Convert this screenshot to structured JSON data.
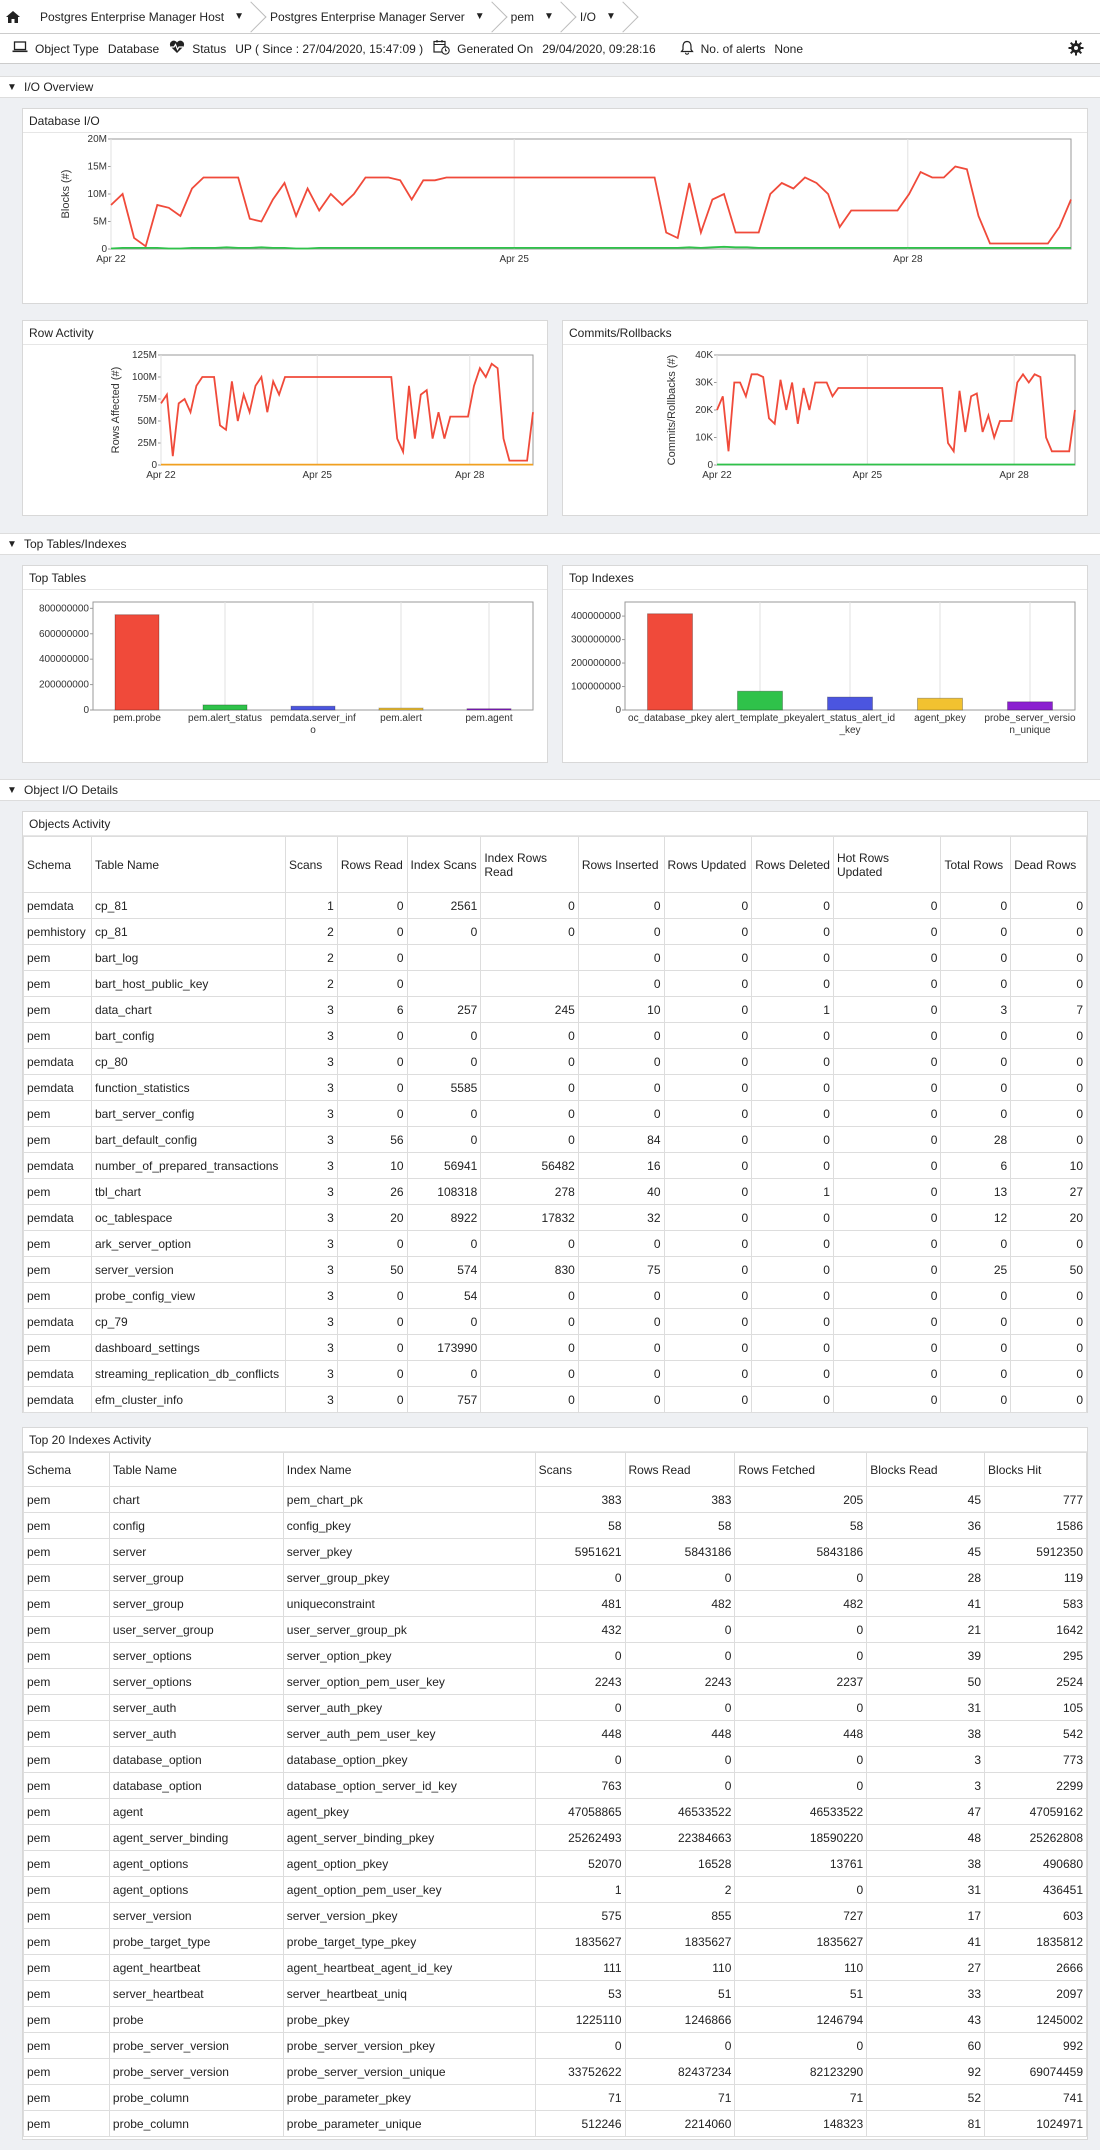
{
  "breadcrumb": [
    {
      "label": "Postgres Enterprise Manager Host"
    },
    {
      "label": "Postgres Enterprise Manager Server"
    },
    {
      "label": "pem"
    },
    {
      "label": "I/O"
    }
  ],
  "info": {
    "object_type_label": "Object Type",
    "object_type_value": "Database",
    "status_label": "Status",
    "status_value": "UP ( Since : 27/04/2020, 15:47:09 )",
    "generated_label": "Generated On",
    "generated_value": "29/04/2020, 09:28:16",
    "alerts_label": "No. of alerts",
    "alerts_value": "None"
  },
  "sections": {
    "io_overview": "I/O Overview",
    "top_tables_indexes": "Top Tables/Indexes",
    "object_io_details": "Object I/O Details"
  },
  "colors": {
    "red": "#f04a3a",
    "green": "#2fc24a",
    "blue": "#4b55e0",
    "yellow": "#f2c230",
    "purple": "#8b1fd0",
    "orange": "#f0a020"
  },
  "chart_data": [
    {
      "id": "database_io",
      "type": "line",
      "title": "Database I/O",
      "ylabel": "Blocks (#)",
      "ylim": [
        0,
        20000000
      ],
      "yticks": [
        "0",
        "5M",
        "10M",
        "15M",
        "20M"
      ],
      "xticks": [
        "Apr 22",
        "Apr 25",
        "Apr 28"
      ],
      "series": [
        {
          "color": "#f04a3a",
          "values": [
            8,
            10,
            2,
            0.5,
            8,
            7.5,
            6,
            11,
            13,
            13,
            13,
            13,
            5.5,
            5,
            9,
            12,
            6,
            11,
            7,
            10,
            8,
            10,
            13,
            13,
            13,
            12.5,
            9,
            12.5,
            12.5,
            13,
            13,
            13,
            13,
            13,
            13,
            13,
            13,
            13,
            13,
            13,
            13,
            13,
            13,
            13,
            13,
            13,
            13,
            13,
            3,
            2,
            12,
            3,
            9,
            10,
            3,
            3,
            3,
            10,
            12,
            11,
            13,
            12,
            10,
            4,
            7,
            7,
            7,
            7,
            7,
            10,
            14,
            13,
            13,
            15,
            14.5,
            6,
            1,
            1,
            1,
            1,
            1,
            1,
            4,
            9
          ]
        },
        {
          "color": "#2fc24a",
          "values": [
            0.1,
            0.2,
            0.2,
            0.2,
            0.2,
            0.1,
            0.1,
            0.2,
            0.2,
            0.2,
            0.3,
            0.2,
            0.2,
            0.3,
            0.2,
            0.2,
            0.1,
            0.1,
            0.2,
            0.2,
            0.2,
            0.2,
            0.2,
            0.2,
            0.2,
            0.2,
            0.2,
            0.2,
            0.2,
            0.2,
            0.2,
            0.2,
            0.2,
            0.2,
            0.2,
            0.2,
            0.2,
            0.2,
            0.2,
            0.2,
            0.2,
            0.2,
            0.2,
            0.2,
            0.2,
            0.2,
            0.2,
            0.2,
            0.2,
            0.2,
            0.3,
            0.2,
            0.3,
            0.4,
            0.3,
            0.3,
            0.2,
            0.2,
            0.2,
            0.2,
            0.2,
            0.2,
            0.2,
            0.2,
            0.2,
            0.2,
            0.2,
            0.2,
            0.2,
            0.2,
            0.2,
            0.2,
            0.2,
            0.2,
            0.2,
            0.2,
            0.2,
            0.2,
            0.2,
            0.2,
            0.2,
            0.2,
            0.2,
            0.2
          ]
        }
      ]
    },
    {
      "id": "row_activity",
      "type": "line",
      "title": "Row Activity",
      "ylabel": "Rows Affected (#)",
      "ylim": [
        0,
        125000000
      ],
      "yticks": [
        "0",
        "25M",
        "50M",
        "75M",
        "100M",
        "125M"
      ],
      "xticks": [
        "Apr 22",
        "Apr 25",
        "Apr 28"
      ],
      "series": [
        {
          "color": "#f04a3a",
          "values": [
            70,
            80,
            10,
            70,
            75,
            60,
            90,
            100,
            100,
            100,
            45,
            40,
            95,
            50,
            80,
            60,
            90,
            100,
            60,
            95,
            80,
            100,
            100,
            100,
            100,
            100,
            100,
            100,
            100,
            100,
            100,
            100,
            100,
            100,
            100,
            100,
            100,
            100,
            100,
            100,
            30,
            15,
            90,
            30,
            80,
            85,
            30,
            60,
            30,
            55,
            55,
            55,
            55,
            90,
            110,
            100,
            115,
            110,
            30,
            5,
            5,
            5,
            5,
            60
          ]
        },
        {
          "color": "#f0a020",
          "values": [
            0.5,
            0.5,
            0.5,
            0.5,
            0.5,
            0.5,
            0.5,
            0.5,
            0.5,
            0.5,
            0.5,
            0.5,
            0.5,
            0.5,
            0.5,
            0.5,
            0.5,
            0.5,
            0.5,
            0.5,
            0.5,
            0.5,
            0.5,
            0.5,
            0.5,
            0.5,
            0.5,
            0.5,
            0.5,
            0.5,
            0.5,
            0.5,
            0.5,
            0.5,
            0.5,
            0.5,
            0.5,
            0.5,
            0.5,
            0.5,
            0.5,
            0.5,
            0.5,
            0.5,
            0.5,
            0.5,
            0.5,
            0.5,
            0.5,
            0.5,
            0.5,
            0.5,
            0.5,
            0.5,
            0.5,
            0.5,
            0.5,
            0.5,
            0.5,
            0.5,
            0.5,
            0.5,
            0.5,
            0.5
          ]
        }
      ]
    },
    {
      "id": "commits_rollbacks",
      "type": "line",
      "title": "Commits/Rollbacks",
      "ylabel": "Commits/Rollbacks (#)",
      "ylim": [
        0,
        40000
      ],
      "yticks": [
        "0",
        "10K",
        "20K",
        "30K",
        "40K"
      ],
      "xticks": [
        "Apr 22",
        "Apr 25",
        "Apr 28"
      ],
      "series": [
        {
          "color": "#f04a3a",
          "values": [
            20,
            25,
            5,
            30,
            30,
            25,
            33,
            33,
            32,
            17,
            15,
            31,
            20,
            30,
            15,
            28,
            20,
            30,
            30,
            30,
            25,
            28,
            28,
            28,
            28,
            28,
            28,
            28,
            28,
            28,
            28,
            28,
            28,
            28,
            28,
            28,
            28,
            28,
            28,
            28,
            8,
            5,
            27,
            12,
            25,
            26,
            12,
            18,
            10,
            16,
            16,
            16,
            30,
            33,
            30,
            33,
            32,
            10,
            5,
            5,
            5,
            5,
            20
          ]
        },
        {
          "color": "#2fc24a",
          "values": [
            0.2,
            0.2,
            0.2,
            0.2,
            0.2,
            0.2,
            0.2,
            0.2,
            0.2,
            0.2,
            0.2,
            0.2,
            0.2,
            0.2,
            0.2,
            0.2,
            0.2,
            0.2,
            0.2,
            0.2,
            0.2,
            0.2,
            0.2,
            0.2,
            0.2,
            0.2,
            0.2,
            0.2,
            0.2,
            0.2,
            0.2,
            0.2,
            0.2,
            0.2,
            0.2,
            0.2,
            0.2,
            0.2,
            0.2,
            0.2,
            0.2,
            0.2,
            0.2,
            0.2,
            0.2,
            0.2,
            0.2,
            0.2,
            0.2,
            0.2,
            0.2,
            0.2,
            0.2,
            0.2,
            0.2,
            0.2,
            0.2,
            0.2,
            0.2,
            0.2,
            0.2,
            0.2,
            0.2
          ]
        }
      ]
    },
    {
      "id": "top_tables",
      "type": "bar",
      "title": "Top Tables",
      "ylim": [
        0,
        850000000
      ],
      "yticks": [
        "0",
        "200000000",
        "400000000",
        "600000000",
        "800000000"
      ],
      "categories": [
        [
          "pem.probe"
        ],
        [
          "pem.alert_status"
        ],
        [
          "pemdata.server_inf",
          "o"
        ],
        [
          "pem.alert"
        ],
        [
          "pem.agent"
        ]
      ],
      "values": [
        750000000,
        40000000,
        30000000,
        15000000,
        10000000
      ],
      "colors": [
        "#f04a3a",
        "#2fc24a",
        "#4b55e0",
        "#f2c230",
        "#8b1fd0"
      ]
    },
    {
      "id": "top_indexes",
      "type": "bar",
      "title": "Top Indexes",
      "ylim": [
        0,
        460000000
      ],
      "yticks": [
        "0",
        "100000000",
        "200000000",
        "300000000",
        "400000000"
      ],
      "categories": [
        [
          "oc_database_pkey"
        ],
        [
          "alert_template_pkey"
        ],
        [
          "alert_status_alert_id",
          "_key"
        ],
        [
          "agent_pkey"
        ],
        [
          "probe_server_versio",
          "n_unique"
        ]
      ],
      "values": [
        410000000,
        80000000,
        55000000,
        50000000,
        35000000
      ],
      "colors": [
        "#f04a3a",
        "#2fc24a",
        "#4b55e0",
        "#f2c230",
        "#8b1fd0"
      ]
    }
  ],
  "objects_activity": {
    "title": "Objects Activity",
    "columns": [
      "Schema",
      "Table Name",
      "Scans",
      "Rows Read",
      "Index Scans",
      "Index Rows Read",
      "Rows Inserted",
      "Rows Updated",
      "Rows Deleted",
      "Hot Rows Updated",
      "Total Rows",
      "Dead Rows"
    ],
    "rows": [
      [
        "pemdata",
        "cp_81",
        "1",
        "0",
        "2561",
        "0",
        "0",
        "0",
        "0",
        "0",
        "0",
        "0"
      ],
      [
        "pemhistory",
        "cp_81",
        "2",
        "0",
        "0",
        "0",
        "0",
        "0",
        "0",
        "0",
        "0",
        "0"
      ],
      [
        "pem",
        "bart_log",
        "2",
        "0",
        "",
        "",
        "0",
        "0",
        "0",
        "0",
        "0",
        "0"
      ],
      [
        "pem",
        "bart_host_public_key",
        "2",
        "0",
        "",
        "",
        "0",
        "0",
        "0",
        "0",
        "0",
        "0"
      ],
      [
        "pem",
        "data_chart",
        "3",
        "6",
        "257",
        "245",
        "10",
        "0",
        "1",
        "0",
        "3",
        "7"
      ],
      [
        "pem",
        "bart_config",
        "3",
        "0",
        "0",
        "0",
        "0",
        "0",
        "0",
        "0",
        "0",
        "0"
      ],
      [
        "pemdata",
        "cp_80",
        "3",
        "0",
        "0",
        "0",
        "0",
        "0",
        "0",
        "0",
        "0",
        "0"
      ],
      [
        "pemdata",
        "function_statistics",
        "3",
        "0",
        "5585",
        "0",
        "0",
        "0",
        "0",
        "0",
        "0",
        "0"
      ],
      [
        "pem",
        "bart_server_config",
        "3",
        "0",
        "0",
        "0",
        "0",
        "0",
        "0",
        "0",
        "0",
        "0"
      ],
      [
        "pem",
        "bart_default_config",
        "3",
        "56",
        "0",
        "0",
        "84",
        "0",
        "0",
        "0",
        "28",
        "0"
      ],
      [
        "pemdata",
        "number_of_prepared_transactions",
        "3",
        "10",
        "56941",
        "56482",
        "16",
        "0",
        "0",
        "0",
        "6",
        "10"
      ],
      [
        "pem",
        "tbl_chart",
        "3",
        "26",
        "108318",
        "278",
        "40",
        "0",
        "1",
        "0",
        "13",
        "27"
      ],
      [
        "pemdata",
        "oc_tablespace",
        "3",
        "20",
        "8922",
        "17832",
        "32",
        "0",
        "0",
        "0",
        "12",
        "20"
      ],
      [
        "pem",
        "ark_server_option",
        "3",
        "0",
        "0",
        "0",
        "0",
        "0",
        "0",
        "0",
        "0",
        "0"
      ],
      [
        "pem",
        "server_version",
        "3",
        "50",
        "574",
        "830",
        "75",
        "0",
        "0",
        "0",
        "25",
        "50"
      ],
      [
        "pem",
        "probe_config_view",
        "3",
        "0",
        "54",
        "0",
        "0",
        "0",
        "0",
        "0",
        "0",
        "0"
      ],
      [
        "pemdata",
        "cp_79",
        "3",
        "0",
        "0",
        "0",
        "0",
        "0",
        "0",
        "0",
        "0",
        "0"
      ],
      [
        "pem",
        "dashboard_settings",
        "3",
        "0",
        "173990",
        "0",
        "0",
        "0",
        "0",
        "0",
        "0",
        "0"
      ],
      [
        "pemdata",
        "streaming_replication_db_conflicts",
        "3",
        "0",
        "0",
        "0",
        "0",
        "0",
        "0",
        "0",
        "0",
        "0"
      ],
      [
        "pemdata",
        "efm_cluster_info",
        "3",
        "0",
        "757",
        "0",
        "0",
        "0",
        "0",
        "0",
        "0",
        "0"
      ]
    ]
  },
  "indexes_activity": {
    "title": "Top 20 Indexes Activity",
    "columns": [
      "Schema",
      "Table Name",
      "Index Name",
      "Scans",
      "Rows Read",
      "Rows Fetched",
      "Blocks Read",
      "Blocks Hit"
    ],
    "rows": [
      [
        "pem",
        "chart",
        "pem_chart_pk",
        "383",
        "383",
        "205",
        "45",
        "777"
      ],
      [
        "pem",
        "config",
        "config_pkey",
        "58",
        "58",
        "58",
        "36",
        "1586"
      ],
      [
        "pem",
        "server",
        "server_pkey",
        "5951621",
        "5843186",
        "5843186",
        "45",
        "5912350"
      ],
      [
        "pem",
        "server_group",
        "server_group_pkey",
        "0",
        "0",
        "0",
        "28",
        "119"
      ],
      [
        "pem",
        "server_group",
        "uniqueconstraint",
        "481",
        "482",
        "482",
        "41",
        "583"
      ],
      [
        "pem",
        "user_server_group",
        "user_server_group_pk",
        "432",
        "0",
        "0",
        "21",
        "1642"
      ],
      [
        "pem",
        "server_options",
        "server_option_pkey",
        "0",
        "0",
        "0",
        "39",
        "295"
      ],
      [
        "pem",
        "server_options",
        "server_option_pem_user_key",
        "2243",
        "2243",
        "2237",
        "50",
        "2524"
      ],
      [
        "pem",
        "server_auth",
        "server_auth_pkey",
        "0",
        "0",
        "0",
        "31",
        "105"
      ],
      [
        "pem",
        "server_auth",
        "server_auth_pem_user_key",
        "448",
        "448",
        "448",
        "38",
        "542"
      ],
      [
        "pem",
        "database_option",
        "database_option_pkey",
        "0",
        "0",
        "0",
        "3",
        "773"
      ],
      [
        "pem",
        "database_option",
        "database_option_server_id_key",
        "763",
        "0",
        "0",
        "3",
        "2299"
      ],
      [
        "pem",
        "agent",
        "agent_pkey",
        "47058865",
        "46533522",
        "46533522",
        "47",
        "47059162"
      ],
      [
        "pem",
        "agent_server_binding",
        "agent_server_binding_pkey",
        "25262493",
        "22384663",
        "18590220",
        "48",
        "25262808"
      ],
      [
        "pem",
        "agent_options",
        "agent_option_pkey",
        "52070",
        "16528",
        "13761",
        "38",
        "490680"
      ],
      [
        "pem",
        "agent_options",
        "agent_option_pem_user_key",
        "1",
        "2",
        "0",
        "31",
        "436451"
      ],
      [
        "pem",
        "server_version",
        "server_version_pkey",
        "575",
        "855",
        "727",
        "17",
        "603"
      ],
      [
        "pem",
        "probe_target_type",
        "probe_target_type_pkey",
        "1835627",
        "1835627",
        "1835627",
        "41",
        "1835812"
      ],
      [
        "pem",
        "agent_heartbeat",
        "agent_heartbeat_agent_id_key",
        "111",
        "110",
        "110",
        "27",
        "2666"
      ],
      [
        "pem",
        "server_heartbeat",
        "server_heartbeat_uniq",
        "53",
        "51",
        "51",
        "33",
        "2097"
      ],
      [
        "pem",
        "probe",
        "probe_pkey",
        "1225110",
        "1246866",
        "1246794",
        "43",
        "1245002"
      ],
      [
        "pem",
        "probe_server_version",
        "probe_server_version_pkey",
        "0",
        "0",
        "0",
        "60",
        "992"
      ],
      [
        "pem",
        "probe_server_version",
        "probe_server_version_unique",
        "33752622",
        "82437234",
        "82123290",
        "92",
        "69074459"
      ],
      [
        "pem",
        "probe_column",
        "probe_parameter_pkey",
        "71",
        "71",
        "71",
        "52",
        "741"
      ],
      [
        "pem",
        "probe_column",
        "probe_parameter_unique",
        "512246",
        "2214060",
        "148323",
        "81",
        "1024971"
      ]
    ]
  }
}
